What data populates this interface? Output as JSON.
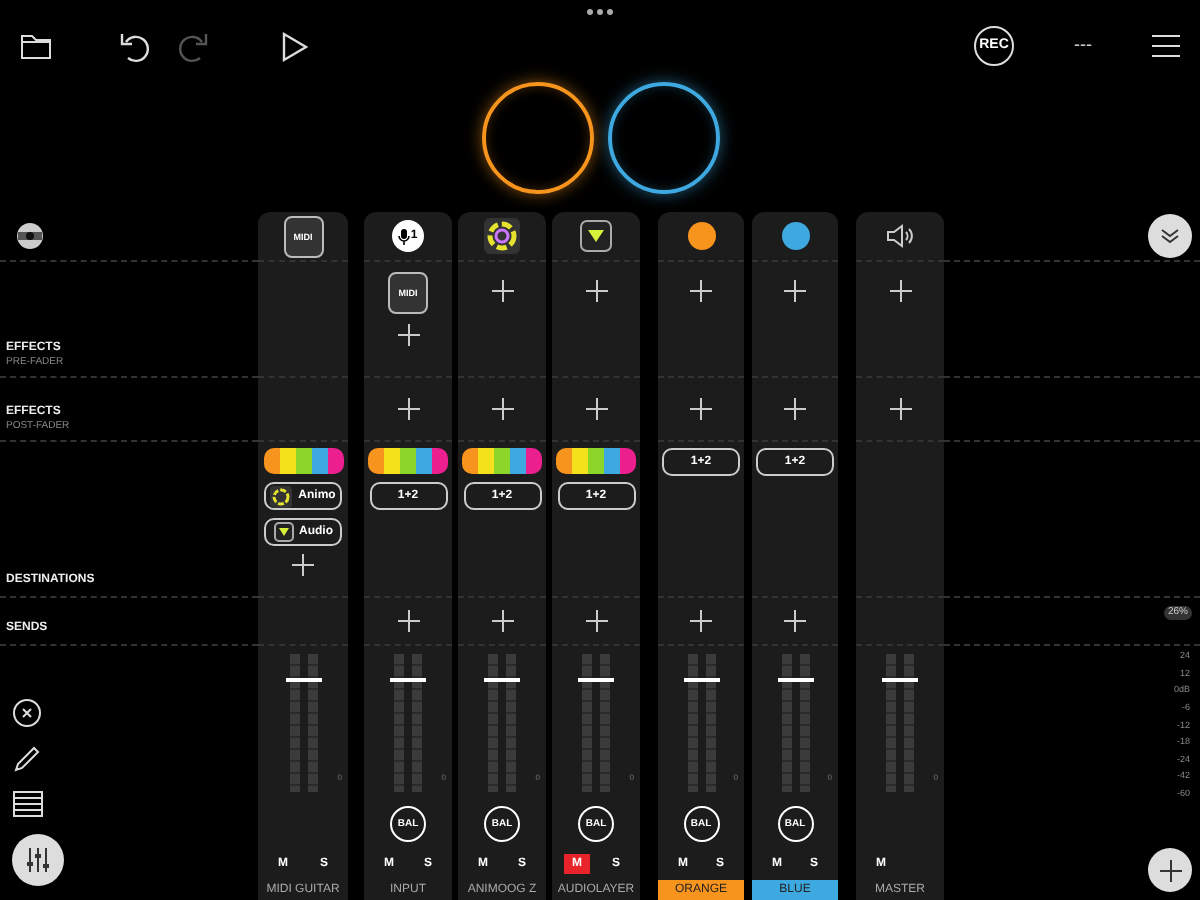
{
  "toolbar": {
    "buttons": [
      {
        "kind": "folder",
        "disabled": false
      },
      {
        "kind": "undo",
        "disabled": false
      },
      {
        "kind": "redo",
        "disabled": true
      },
      {
        "kind": "play",
        "disabled": false
      }
    ],
    "record": "REC",
    "counter": "---"
  },
  "sections": [
    {
      "title": "EFFECTS",
      "subtitle": "PRE-FADER"
    },
    {
      "title": "EFFECTS",
      "subtitle": "POST-FADER"
    },
    {
      "title": "DESTINATIONS"
    },
    {
      "title": "SENDS"
    }
  ],
  "channels": [
    {
      "name": "MIDI GUITAR",
      "header": {
        "kind": "midi",
        "label": "MIDI"
      },
      "destinations": [
        {
          "kind": "colorbar"
        },
        {
          "kind": "ring_app",
          "label": "Animo"
        },
        {
          "kind": "triangle_app",
          "label": "Audio"
        },
        {
          "kind": "add"
        }
      ],
      "fader": {
        "level": 0.8
      },
      "meter_label": "0",
      "mute": {
        "label": "M",
        "on": false
      },
      "solo": "S"
    },
    {
      "name": "INPUT",
      "header": {
        "kind": "mic",
        "label": "1"
      },
      "pre_fader": [
        {
          "kind": "midi",
          "label": "MIDI"
        },
        {
          "kind": "add"
        }
      ],
      "post_fader": [
        {
          "kind": "add"
        }
      ],
      "destinations": [
        {
          "kind": "colorbar"
        },
        {
          "kind": "route",
          "label": "1+2"
        }
      ],
      "sends": [
        {
          "kind": "add"
        }
      ],
      "fader": {
        "level": 0.8
      },
      "meter_label": "0",
      "balance": "BAL",
      "mute": {
        "label": "M",
        "on": false
      },
      "solo": "S"
    },
    {
      "name": "ANIMOOG Z",
      "header": {
        "kind": "ring"
      },
      "pre_fader": [
        {
          "kind": "add"
        }
      ],
      "post_fader": [
        {
          "kind": "add"
        }
      ],
      "destinations": [
        {
          "kind": "colorbar"
        },
        {
          "kind": "route",
          "label": "1+2"
        }
      ],
      "sends": [
        {
          "kind": "add"
        }
      ],
      "fader": {
        "level": 0.8
      },
      "meter_label": "0",
      "balance": "BAL",
      "mute": {
        "label": "M",
        "on": false
      },
      "solo": "S"
    },
    {
      "name": "AUDIOLAYER",
      "header": {
        "kind": "triangle"
      },
      "pre_fader": [
        {
          "kind": "add"
        }
      ],
      "post_fader": [
        {
          "kind": "add"
        }
      ],
      "destinations": [
        {
          "kind": "colorbar"
        },
        {
          "kind": "route",
          "label": "1+2"
        }
      ],
      "sends": [
        {
          "kind": "add"
        }
      ],
      "fader": {
        "level": 0.8
      },
      "meter_label": "0",
      "balance": "BAL",
      "mute": {
        "label": "M",
        "on": true
      },
      "solo": "S"
    },
    {
      "name": "ORANGE",
      "color": "#f7941d",
      "header": {
        "kind": "dot"
      },
      "pre_fader": [
        {
          "kind": "add"
        }
      ],
      "post_fader": [
        {
          "kind": "add"
        }
      ],
      "destinations": [
        {
          "kind": "route",
          "label": "1+2"
        }
      ],
      "sends": [
        {
          "kind": "add"
        }
      ],
      "fader": {
        "level": 0.8
      },
      "meter_label": "0",
      "balance": "BAL",
      "mute": {
        "label": "M",
        "on": false
      },
      "solo": "S"
    },
    {
      "name": "BLUE",
      "color": "#3ea9e0",
      "header": {
        "kind": "dot"
      },
      "pre_fader": [
        {
          "kind": "add"
        }
      ],
      "post_fader": [
        {
          "kind": "add"
        }
      ],
      "destinations": [
        {
          "kind": "route",
          "label": "1+2"
        }
      ],
      "sends": [
        {
          "kind": "add"
        }
      ],
      "fader": {
        "level": 0.8
      },
      "meter_label": "0",
      "balance": "BAL",
      "mute": {
        "label": "M",
        "on": false
      },
      "solo": "S"
    },
    {
      "name": "MASTER",
      "header": {
        "kind": "speaker"
      },
      "pre_fader": [
        {
          "kind": "add"
        }
      ],
      "post_fader": [
        {
          "kind": "add"
        }
      ],
      "fader": {
        "level": 0.8
      },
      "meter_label": "0",
      "mute": {
        "label": "M",
        "on": false
      }
    }
  ],
  "scale": {
    "percent": "26%",
    "ticks": [
      "24",
      "12",
      "0dB",
      "-6",
      "-12",
      "-18",
      "-24",
      "-42",
      "-60"
    ]
  }
}
